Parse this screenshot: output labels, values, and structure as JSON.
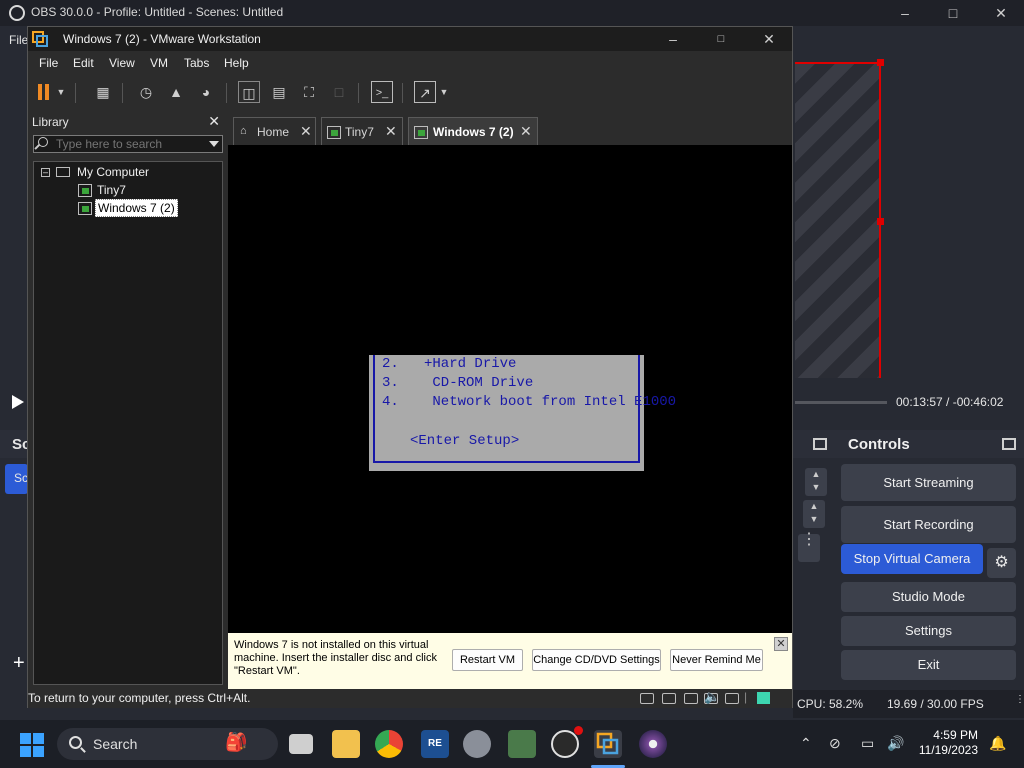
{
  "obs": {
    "title": "OBS 30.0.0 - Profile: Untitled - Scenes: Untitled",
    "menu_file": "File",
    "timeline_time": "00:13:57  /  -00:46:02",
    "scenes_partial": "Sc",
    "scene_item_partial": "Sc",
    "controls": {
      "header": "Controls",
      "start_streaming": "Start Streaming",
      "start_recording": "Start Recording",
      "stop_virtual_camera": "Stop Virtual Camera",
      "studio_mode": "Studio Mode",
      "settings": "Settings",
      "exit": "Exit"
    },
    "status": {
      "cpu": "CPU: 58.2%",
      "fps": "19.69 / 30.00 FPS"
    }
  },
  "vmware": {
    "title": "Windows 7 (2) - VMware Workstation",
    "menu": [
      "File",
      "Edit",
      "View",
      "VM",
      "Tabs",
      "Help"
    ],
    "library": {
      "header": "Library",
      "search_placeholder": "Type here to search",
      "root": "My Computer",
      "items": [
        "Tiny7",
        "Windows 7 (2)"
      ]
    },
    "tabs": [
      "Home",
      "Tiny7",
      "Windows 7 (2)"
    ],
    "boot_menu": {
      "lines": [
        "2.   +Hard Drive",
        "3.    CD-ROM Drive",
        "4.    Network boot from Intel E1000",
        "<Enter Setup>"
      ]
    },
    "notice": {
      "message": "Windows 7 is not installed on this virtual machine. Insert the installer disc and click \"Restart VM\".",
      "restart": "Restart VM",
      "change_cd": "Change CD/DVD Settings",
      "never_remind": "Never Remind Me"
    },
    "status_text": "To return to your computer, press Ctrl+Alt."
  },
  "taskbar": {
    "search_label": "Search",
    "time": "4:59 PM",
    "date": "11/19/2023"
  },
  "colors": {
    "obs_accent": "#2c5bd6",
    "selection_red": "#e00000",
    "boot_blue": "#1818a8"
  }
}
